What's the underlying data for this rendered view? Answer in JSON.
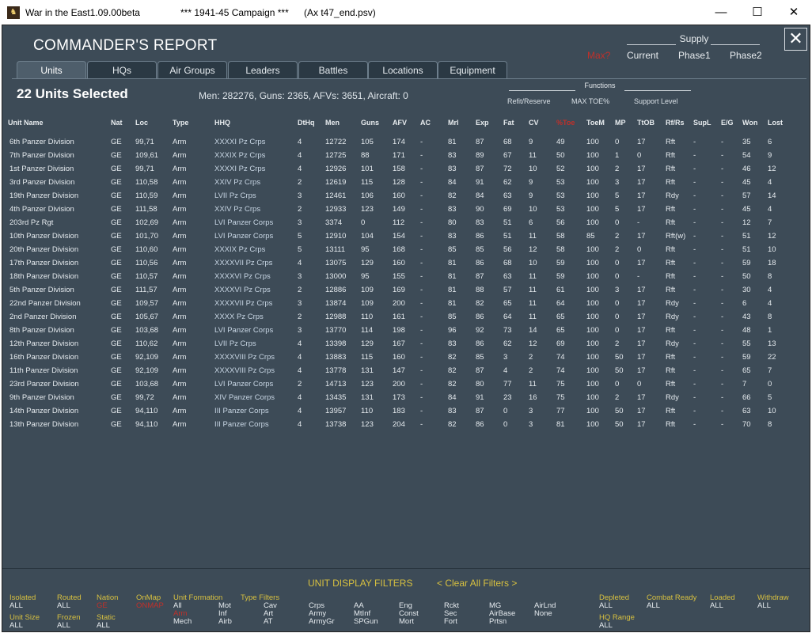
{
  "window": {
    "title": "War in the East1.09.00beta",
    "campaign": "***   1941-45 Campaign   ***",
    "file": "(Ax t47_end.psv)",
    "minimize": "—",
    "maximize": "☐",
    "close": "✕"
  },
  "report": {
    "title": "COMMANDER'S REPORT",
    "close": "✕"
  },
  "supply": {
    "label": "Supply",
    "options": [
      "Max?",
      "Current",
      "Phase1",
      "Phase2"
    ]
  },
  "tabs": [
    "Units",
    "HQs",
    "Air Groups",
    "Leaders",
    "Battles",
    "Locations",
    "Equipment"
  ],
  "summary": {
    "selected": "22 Units Selected",
    "stats": "Men: 282276, Guns: 2365, AFVs: 3651, Aircraft: 0"
  },
  "functions": {
    "label": "Functions",
    "options": [
      "Refit/Reserve",
      "MAX TOE%",
      "Support Level"
    ]
  },
  "table": {
    "headers": [
      "Unit Name",
      "Nat",
      "Loc",
      "Type",
      "HHQ",
      "DtHq",
      "Men",
      "Guns",
      "AFV",
      "AC",
      "Mrl",
      "Exp",
      "Fat",
      "CV",
      "%Toe",
      "ToeM",
      "MP",
      "TtOB",
      "Rf/Rs",
      "SupL",
      "E/G",
      "Won",
      "Lost"
    ],
    "rows": [
      [
        "6th Panzer Division",
        "GE",
        "99,71",
        "Arm",
        "XXXXI Pz Crps",
        "4",
        "12722",
        "105",
        "174",
        "-",
        "81",
        "87",
        "68",
        "9",
        "49",
        "100",
        "0",
        "17",
        "Rft",
        "-",
        "-",
        "35",
        "6"
      ],
      [
        "7th Panzer Division",
        "GE",
        "109,61",
        "Arm",
        "XXXIX Pz Crps",
        "4",
        "12725",
        "88",
        "171",
        "-",
        "83",
        "89",
        "67",
        "11",
        "50",
        "100",
        "1",
        "0",
        "Rft",
        "-",
        "-",
        "54",
        "9"
      ],
      [
        "1st Panzer Division",
        "GE",
        "99,71",
        "Arm",
        "XXXXI Pz Crps",
        "4",
        "12926",
        "101",
        "158",
        "-",
        "83",
        "87",
        "72",
        "10",
        "52",
        "100",
        "2",
        "17",
        "Rft",
        "-",
        "-",
        "46",
        "12"
      ],
      [
        "3rd Panzer Division",
        "GE",
        "110,58",
        "Arm",
        "XXIV Pz Crps",
        "2",
        "12619",
        "115",
        "128",
        "-",
        "84",
        "91",
        "62",
        "9",
        "53",
        "100",
        "3",
        "17",
        "Rft",
        "-",
        "-",
        "45",
        "4"
      ],
      [
        "19th Panzer Division",
        "GE",
        "110,59",
        "Arm",
        "LVII Pz Crps",
        "3",
        "12461",
        "106",
        "160",
        "-",
        "82",
        "84",
        "63",
        "9",
        "53",
        "100",
        "5",
        "17",
        "Rdy",
        "-",
        "-",
        "57",
        "14"
      ],
      [
        "4th Panzer Division",
        "GE",
        "111,58",
        "Arm",
        "XXIV Pz Crps",
        "2",
        "12933",
        "123",
        "149",
        "-",
        "83",
        "90",
        "69",
        "10",
        "53",
        "100",
        "5",
        "17",
        "Rft",
        "-",
        "-",
        "45",
        "4"
      ],
      [
        "203rd Pz Rgt",
        "GE",
        "102,69",
        "Arm",
        "LVI Panzer Corps",
        "3",
        "3374",
        "0",
        "112",
        "-",
        "80",
        "83",
        "51",
        "6",
        "56",
        "100",
        "0",
        "-",
        "Rft",
        "-",
        "-",
        "12",
        "7"
      ],
      [
        "10th Panzer Division",
        "GE",
        "101,70",
        "Arm",
        "LVI Panzer Corps",
        "5",
        "12910",
        "104",
        "154",
        "-",
        "83",
        "86",
        "51",
        "11",
        "58",
        "85",
        "2",
        "17",
        "Rft(w)",
        "-",
        "-",
        "51",
        "12"
      ],
      [
        "20th Panzer Division",
        "GE",
        "110,60",
        "Arm",
        "XXXIX Pz Crps",
        "5",
        "13111",
        "95",
        "168",
        "-",
        "85",
        "85",
        "56",
        "12",
        "58",
        "100",
        "2",
        "0",
        "Rft",
        "-",
        "-",
        "51",
        "10"
      ],
      [
        "17th Panzer Division",
        "GE",
        "110,56",
        "Arm",
        "XXXXVII Pz Crps",
        "4",
        "13075",
        "129",
        "160",
        "-",
        "81",
        "86",
        "68",
        "10",
        "59",
        "100",
        "0",
        "17",
        "Rft",
        "-",
        "-",
        "59",
        "18"
      ],
      [
        "18th Panzer Division",
        "GE",
        "110,57",
        "Arm",
        "XXXXVI Pz Crps",
        "3",
        "13000",
        "95",
        "155",
        "-",
        "81",
        "87",
        "63",
        "11",
        "59",
        "100",
        "0",
        "-",
        "Rft",
        "-",
        "-",
        "50",
        "8"
      ],
      [
        "5th Panzer Division",
        "GE",
        "111,57",
        "Arm",
        "XXXXVI Pz Crps",
        "2",
        "12886",
        "109",
        "169",
        "-",
        "81",
        "88",
        "57",
        "11",
        "61",
        "100",
        "3",
        "17",
        "Rft",
        "-",
        "-",
        "30",
        "4"
      ],
      [
        "22nd Panzer Division",
        "GE",
        "109,57",
        "Arm",
        "XXXXVII Pz Crps",
        "3",
        "13874",
        "109",
        "200",
        "-",
        "81",
        "82",
        "65",
        "11",
        "64",
        "100",
        "0",
        "17",
        "Rdy",
        "-",
        "-",
        "6",
        "4"
      ],
      [
        "2nd Panzer Division",
        "GE",
        "105,67",
        "Arm",
        "XXXX Pz Crps",
        "2",
        "12988",
        "110",
        "161",
        "-",
        "85",
        "86",
        "64",
        "11",
        "65",
        "100",
        "0",
        "17",
        "Rdy",
        "-",
        "-",
        "43",
        "8"
      ],
      [
        "8th Panzer Division",
        "GE",
        "103,68",
        "Arm",
        "LVI Panzer Corps",
        "3",
        "13770",
        "114",
        "198",
        "-",
        "96",
        "92",
        "73",
        "14",
        "65",
        "100",
        "0",
        "17",
        "Rft",
        "-",
        "-",
        "48",
        "1"
      ],
      [
        "12th Panzer Division",
        "GE",
        "110,62",
        "Arm",
        "LVII Pz Crps",
        "4",
        "13398",
        "129",
        "167",
        "-",
        "83",
        "86",
        "62",
        "12",
        "69",
        "100",
        "2",
        "17",
        "Rdy",
        "-",
        "-",
        "55",
        "13"
      ],
      [
        "16th Panzer Division",
        "GE",
        "92,109",
        "Arm",
        "XXXXVIII Pz Crps",
        "4",
        "13883",
        "115",
        "160",
        "-",
        "82",
        "85",
        "3",
        "2",
        "74",
        "100",
        "50",
        "17",
        "Rft",
        "-",
        "-",
        "59",
        "22"
      ],
      [
        "11th Panzer Division",
        "GE",
        "92,109",
        "Arm",
        "XXXXVIII Pz Crps",
        "4",
        "13778",
        "131",
        "147",
        "-",
        "82",
        "87",
        "4",
        "2",
        "74",
        "100",
        "50",
        "17",
        "Rft",
        "-",
        "-",
        "65",
        "7"
      ],
      [
        "23rd Panzer Division",
        "GE",
        "103,68",
        "Arm",
        "LVI Panzer Corps",
        "2",
        "14713",
        "123",
        "200",
        "-",
        "82",
        "80",
        "77",
        "11",
        "75",
        "100",
        "0",
        "0",
        "Rft",
        "-",
        "-",
        "7",
        "0"
      ],
      [
        "9th Panzer Division",
        "GE",
        "99,72",
        "Arm",
        "XIV Panzer Corps",
        "4",
        "13435",
        "131",
        "173",
        "-",
        "84",
        "91",
        "23",
        "16",
        "75",
        "100",
        "2",
        "17",
        "Rdy",
        "-",
        "-",
        "66",
        "5"
      ],
      [
        "14th Panzer Division",
        "GE",
        "94,110",
        "Arm",
        "III Panzer Corps",
        "4",
        "13957",
        "110",
        "183",
        "-",
        "83",
        "87",
        "0",
        "3",
        "77",
        "100",
        "50",
        "17",
        "Rft",
        "-",
        "-",
        "63",
        "10"
      ],
      [
        "13th Panzer Division",
        "GE",
        "94,110",
        "Arm",
        "III Panzer Corps",
        "4",
        "13738",
        "123",
        "204",
        "-",
        "82",
        "86",
        "0",
        "3",
        "81",
        "100",
        "50",
        "17",
        "Rft",
        "-",
        "-",
        "70",
        "8"
      ]
    ]
  },
  "filters": {
    "title": "UNIT DISPLAY FILTERS",
    "clear": "< Clear All Filters >",
    "isolated": {
      "label": "Isolated",
      "value": "ALL"
    },
    "routed": {
      "label": "Routed",
      "value": "ALL"
    },
    "nation": {
      "label": "Nation",
      "value": "GE"
    },
    "onmap": {
      "label": "OnMap",
      "value": "ONMAP"
    },
    "unit_formation_label": "Unit  Formation",
    "type_filters_label": "Type   Filters",
    "unit_size": {
      "label": "Unit Size",
      "value": "ALL"
    },
    "frozen": {
      "label": "Frozen",
      "value": "ALL"
    },
    "static": {
      "label": "Static",
      "value": "ALL"
    },
    "formation_col1": [
      "All",
      "Arm",
      "Mech"
    ],
    "formation_col2": [
      "Mot",
      "Inf",
      "Airb"
    ],
    "type_col1": [
      "Cav",
      "Art",
      "AT"
    ],
    "type_col2": [
      "Crps",
      "Army",
      "ArmyGr"
    ],
    "type_col3": [
      "AA",
      "MtInf",
      "SPGun"
    ],
    "type_col4": [
      "Eng",
      "Const",
      "Mort"
    ],
    "type_col5": [
      "Rckt",
      "Sec",
      "Fort"
    ],
    "type_col6": [
      "MG",
      "AirBase",
      "Prtsn"
    ],
    "type_col7": [
      "AirLnd",
      "None"
    ],
    "depleted": {
      "label": "Depleted",
      "value": "ALL"
    },
    "combat_ready": {
      "label": "Combat Ready",
      "value": "ALL"
    },
    "loaded": {
      "label": "Loaded",
      "value": "ALL"
    },
    "withdraw": {
      "label": "Withdraw",
      "value": "ALL"
    },
    "hq_range": {
      "label": "HQ Range",
      "value": "ALL"
    }
  },
  "colors": {
    "panel": "#3d4b57",
    "filter_label": "#d7c040",
    "highlight_red": "#c0302a"
  }
}
